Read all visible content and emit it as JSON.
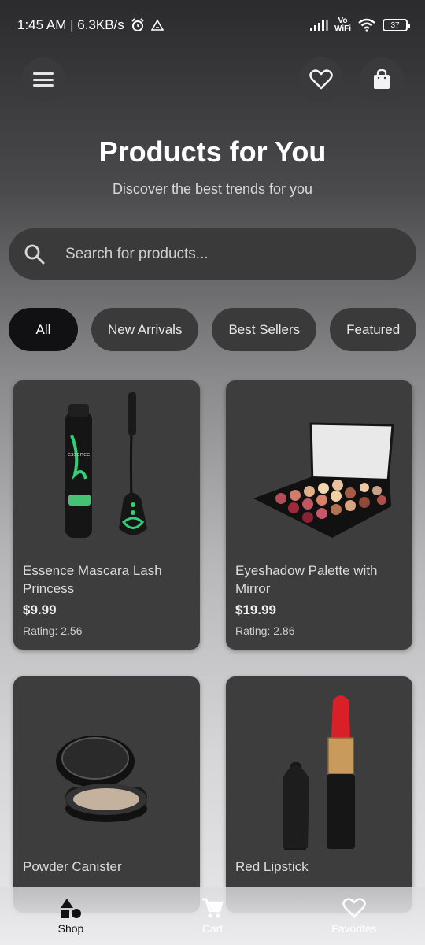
{
  "status": {
    "time_speed": "1:45 AM | 6.3KB/s",
    "vo": "Vo",
    "wifi": "WiFi",
    "battery": "37"
  },
  "header": {
    "title": "Products for You",
    "subtitle": "Discover the best trends for you"
  },
  "search": {
    "placeholder": "Search for products..."
  },
  "chips": [
    "All",
    "New Arrivals",
    "Best Sellers",
    "Featured"
  ],
  "products": [
    {
      "name": "Essence Mascara Lash Princess",
      "price": "$9.99",
      "rating": "Rating: 2.56"
    },
    {
      "name": "Eyeshadow Palette with Mirror",
      "price": "$19.99",
      "rating": "Rating: 2.86"
    },
    {
      "name": "Powder Canister",
      "price": "",
      "rating": ""
    },
    {
      "name": "Red Lipstick",
      "price": "",
      "rating": ""
    }
  ],
  "nav": {
    "shop": "Shop",
    "cart": "Cart",
    "favorites": "Favorites"
  },
  "colors": {
    "accent_lipstick": "#d91f27",
    "chip_active": "#111114",
    "card_bg": "#3d3d3d"
  }
}
